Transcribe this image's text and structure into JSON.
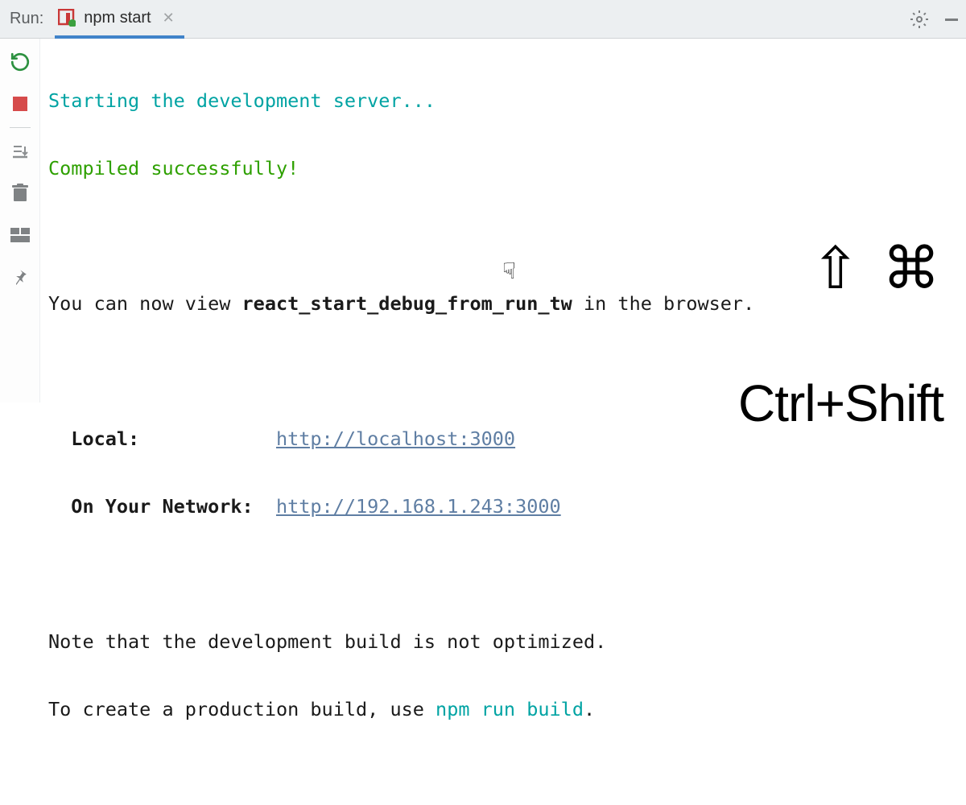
{
  "header": {
    "run_label": "Run:",
    "tab_label": "npm start"
  },
  "console": {
    "line1": "Starting the development server...",
    "line2": "Compiled successfully!",
    "line3_prefix": "You can now view ",
    "line3_bold": "react_start_debug_from_run_tw",
    "line3_suffix": " in the browser.",
    "local_label": "Local:",
    "local_url": "http://localhost:3000",
    "network_label": "On Your Network:",
    "network_url": "http://192.168.1.243:3000",
    "note1": "Note that the development build is not optimized.",
    "note2_prefix": "To create a production build, use ",
    "note2_cmd": "npm run build",
    "note2_suffix": "."
  },
  "overlay": {
    "symbols": "⇧ ⌘",
    "text": "Ctrl+Shift"
  }
}
